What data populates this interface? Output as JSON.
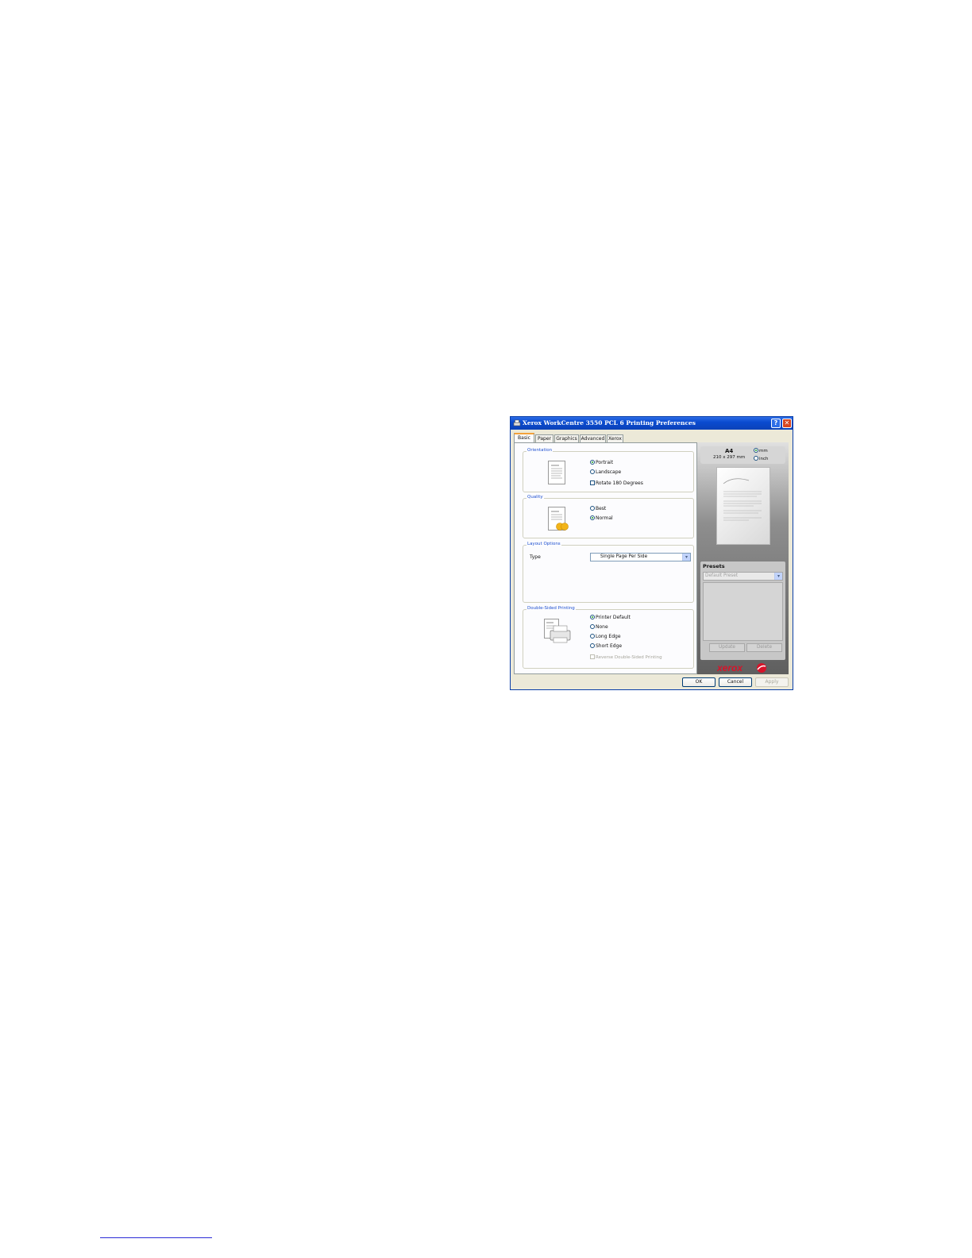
{
  "window": {
    "title": "Xerox WorkCentre 3550 PCL 6 Printing Preferences",
    "help_label": "?",
    "close_label": "✕"
  },
  "tabs": [
    {
      "label": "Basic",
      "active": true
    },
    {
      "label": "Paper"
    },
    {
      "label": "Graphics"
    },
    {
      "label": "Advanced"
    },
    {
      "label": "Xerox"
    }
  ],
  "orientation": {
    "title": "Orientation",
    "options": [
      "Portrait",
      "Landscape"
    ],
    "selected": "Portrait",
    "rotate_label": "Rotate 180 Degrees"
  },
  "quality": {
    "title": "Quality",
    "options": [
      "Best",
      "Normal"
    ],
    "selected": "Normal"
  },
  "layout": {
    "title": "Layout Options",
    "type_label": "Type",
    "type_value": "Single Page Per Side"
  },
  "duplex": {
    "title": "Double-Sided Printing",
    "options": [
      "Printer Default",
      "None",
      "Long Edge",
      "Short Edge"
    ],
    "selected": "Printer Default",
    "reverse_label": "Reverse Double-Sided Printing"
  },
  "paper": {
    "size": "A4",
    "dimensions": "210 x 297 mm",
    "units": [
      "mm",
      "inch"
    ],
    "selected_unit": "mm"
  },
  "presets": {
    "title": "Presets",
    "value": "Default Preset",
    "update_label": "Update",
    "delete_label": "Delete"
  },
  "logo": "xerox",
  "buttons": {
    "ok": "OK",
    "cancel": "Cancel",
    "apply": "Apply"
  }
}
